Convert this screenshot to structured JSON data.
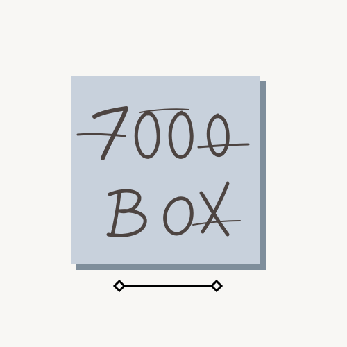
{
  "colors": {
    "background": "#f8f7f4",
    "box_fill": "#c8d1dc",
    "box_shadow": "#7f8e9b",
    "ink": "#4d4441",
    "divider": "#000000"
  },
  "logo": {
    "line1": "7000",
    "line2": "BOX"
  },
  "divider": {
    "left_icon": "diamond-icon",
    "right_icon": "diamond-icon"
  }
}
